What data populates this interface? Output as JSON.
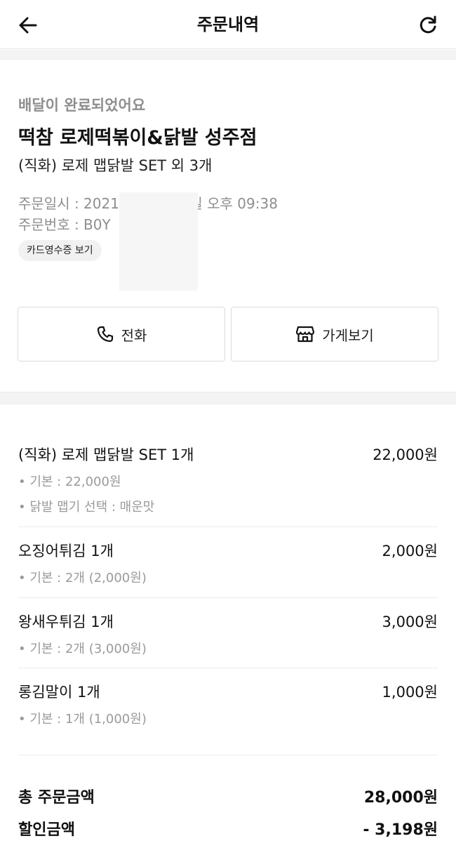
{
  "header": {
    "title": "주문내역"
  },
  "order": {
    "status": "배달이 완료되었어요",
    "store_name": "떡참 로제떡볶이&닭발 성주점",
    "summary": "(직화) 로제 맵닭발 SET 외 3개",
    "date_text": "주문일시 : 2021년 05월 26일 오후 09:38",
    "number_text": "주문번호 : B0Y",
    "receipt_label": "카드영수증 보기"
  },
  "actions": {
    "call_label": "전화",
    "store_label": "가게보기"
  },
  "items": [
    {
      "name": "(직화) 로제 맵닭발 SET 1개",
      "price": "22,000원",
      "options": [
        "• 기본 : 22,000원",
        "• 닭발 맵기 선택 : 매운맛"
      ]
    },
    {
      "name": "오징어튀김 1개",
      "price": "2,000원",
      "options": [
        "• 기본 : 2개 (2,000원)"
      ]
    },
    {
      "name": "왕새우튀김 1개",
      "price": "3,000원",
      "options": [
        "• 기본 : 2개 (3,000원)"
      ]
    },
    {
      "name": "롱김말이 1개",
      "price": "1,000원",
      "options": [
        "• 기본 : 1개 (1,000원)"
      ]
    }
  ],
  "totals": {
    "order_label": "총 주문금액",
    "order_value": "28,000원",
    "discount_label": "할인금액",
    "discount_value": "- 3,198원"
  }
}
